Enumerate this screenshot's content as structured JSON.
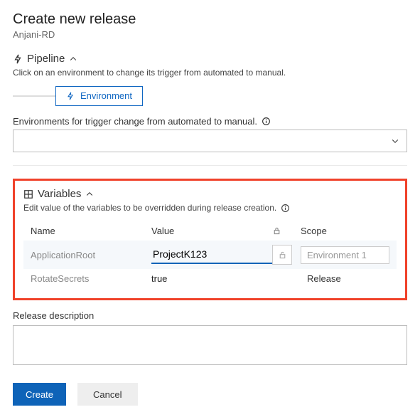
{
  "page": {
    "title": "Create new release",
    "subtitle": "Anjani-RD"
  },
  "pipeline": {
    "label": "Pipeline",
    "help": "Click on an environment to change its trigger from automated to manual.",
    "stage": "Environment"
  },
  "envs": {
    "label": "Environments for trigger change from automated to manual."
  },
  "variables": {
    "label": "Variables",
    "help": "Edit value of the variables to be overridden during release creation.",
    "columns": {
      "name": "Name",
      "value": "Value",
      "scope": "Scope"
    },
    "rows": [
      {
        "name": "ApplicationRoot",
        "value": "ProjectK123",
        "scope": "Environment 1",
        "editing": true
      },
      {
        "name": "RotateSecrets",
        "value": "true",
        "scope": "Release",
        "editing": false
      }
    ]
  },
  "description": {
    "label": "Release description",
    "value": ""
  },
  "actions": {
    "create": "Create",
    "cancel": "Cancel"
  }
}
